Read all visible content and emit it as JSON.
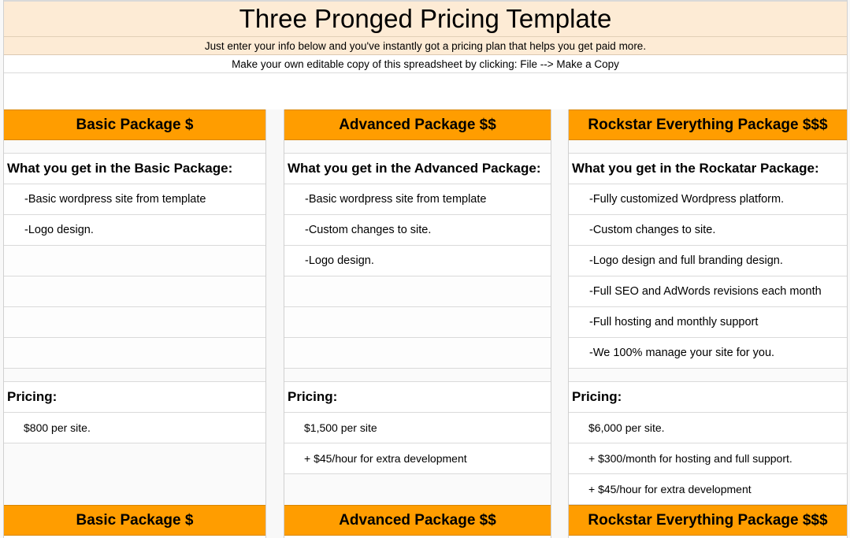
{
  "sheet": {
    "title": "Three Pronged Pricing Template",
    "subtitle": "Just enter your info below and you've instantly got a pricing plan that helps you get paid more.",
    "copy_instructions": "Make your own editable copy of this spreadsheet by clicking:  File --> Make a Copy"
  },
  "colors": {
    "header_orange": "#ff9d00",
    "title_peach": "#fdebd5"
  },
  "packages": [
    {
      "name": "Basic Package $",
      "features_heading": "What you get in the Basic Package:",
      "features": [
        "-Basic wordpress site from template",
        "-Logo design."
      ],
      "pricing_heading": "Pricing:",
      "pricing": [
        "$800 per site."
      ]
    },
    {
      "name": "Advanced Package $$",
      "features_heading": "What you get in the Advanced Package:",
      "features": [
        "-Basic wordpress site from template",
        "-Custom changes to site.",
        "-Logo design."
      ],
      "pricing_heading": "Pricing:",
      "pricing": [
        "$1,500 per site",
        "+ $45/hour for extra development"
      ]
    },
    {
      "name": "Rockstar Everything Package $$$",
      "features_heading": "What you get in the Rockatar Package:",
      "features": [
        "-Fully customized Wordpress platform.",
        "-Custom changes to site.",
        "-Logo design and full branding design.",
        "-Full SEO and AdWords revisions each month",
        "-Full hosting and monthly support",
        "-We 100% manage your site for you."
      ],
      "pricing_heading": "Pricing:",
      "pricing": [
        "$6,000 per site.",
        "+ $300/month for hosting and full support.",
        "+ $45/hour for extra development"
      ]
    }
  ]
}
